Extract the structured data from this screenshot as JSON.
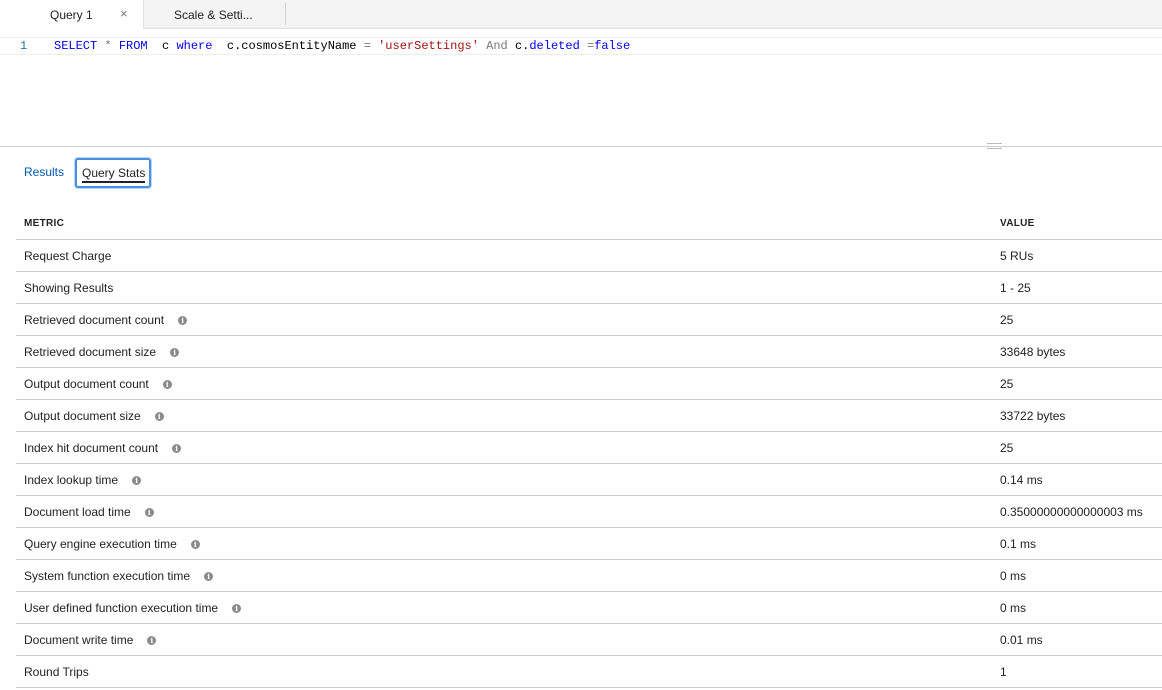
{
  "tabs": [
    {
      "label": "Query 1",
      "close": "×"
    },
    {
      "label": "Scale & Setti..."
    }
  ],
  "editor": {
    "line_number": "1",
    "tokens": {
      "t1": "SELECT",
      "t2": " * ",
      "t3": "FROM",
      "t4": "  c ",
      "t5": "where",
      "t6": "  c.cosmosEntityName ",
      "t7": "=",
      "t8": " ",
      "t9": "'userSettings'",
      "t10": " And ",
      "t11": "c.",
      "t12": "deleted",
      "t13": " =",
      "t14": "false"
    }
  },
  "result_tabs": {
    "results": "Results",
    "query_stats": "Query Stats"
  },
  "metrics": {
    "header": {
      "metric": "METRIC",
      "value": "VALUE"
    },
    "rows": [
      {
        "metric": "Request Charge",
        "value": "5 RUs",
        "info": false
      },
      {
        "metric": "Showing Results",
        "value": "1 - 25",
        "info": false
      },
      {
        "metric": "Retrieved document count",
        "value": "25",
        "info": true
      },
      {
        "metric": "Retrieved document size",
        "value": "33648 bytes",
        "info": true
      },
      {
        "metric": "Output document count",
        "value": "25",
        "info": true
      },
      {
        "metric": "Output document size",
        "value": "33722 bytes",
        "info": true
      },
      {
        "metric": "Index hit document count",
        "value": "25",
        "info": true
      },
      {
        "metric": "Index lookup time",
        "value": "0.14 ms",
        "info": true
      },
      {
        "metric": "Document load time",
        "value": "0.35000000000000003 ms",
        "info": true
      },
      {
        "metric": "Query engine execution time",
        "value": "0.1 ms",
        "info": true
      },
      {
        "metric": "System function execution time",
        "value": "0 ms",
        "info": true
      },
      {
        "metric": "User defined function execution time",
        "value": "0 ms",
        "info": true
      },
      {
        "metric": "Document write time",
        "value": "0.01 ms",
        "info": true
      },
      {
        "metric": "Round Trips",
        "value": "1",
        "info": false
      }
    ],
    "info_icon": "i"
  }
}
